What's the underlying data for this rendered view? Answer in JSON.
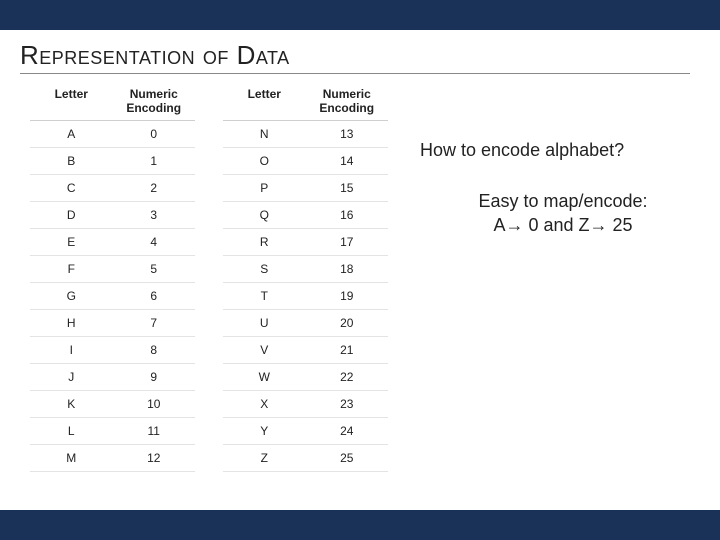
{
  "title": "Representation of Data",
  "headers": {
    "letter": "Letter",
    "encoding": "Numeric Encoding"
  },
  "chart_data": {
    "type": "table",
    "title": "Alphabet numeric encoding",
    "columns": [
      "Letter",
      "Numeric Encoding"
    ],
    "rows": [
      [
        "A",
        0
      ],
      [
        "B",
        1
      ],
      [
        "C",
        2
      ],
      [
        "D",
        3
      ],
      [
        "E",
        4
      ],
      [
        "F",
        5
      ],
      [
        "G",
        6
      ],
      [
        "H",
        7
      ],
      [
        "I",
        8
      ],
      [
        "J",
        9
      ],
      [
        "K",
        10
      ],
      [
        "L",
        11
      ],
      [
        "M",
        12
      ],
      [
        "N",
        13
      ],
      [
        "O",
        14
      ],
      [
        "P",
        15
      ],
      [
        "Q",
        16
      ],
      [
        "R",
        17
      ],
      [
        "S",
        18
      ],
      [
        "T",
        19
      ],
      [
        "U",
        20
      ],
      [
        "V",
        21
      ],
      [
        "W",
        22
      ],
      [
        "X",
        23
      ],
      [
        "Y",
        24
      ],
      [
        "Z",
        25
      ]
    ]
  },
  "table_left": [
    {
      "letter": "A",
      "enc": "0"
    },
    {
      "letter": "B",
      "enc": "1"
    },
    {
      "letter": "C",
      "enc": "2"
    },
    {
      "letter": "D",
      "enc": "3"
    },
    {
      "letter": "E",
      "enc": "4"
    },
    {
      "letter": "F",
      "enc": "5"
    },
    {
      "letter": "G",
      "enc": "6"
    },
    {
      "letter": "H",
      "enc": "7"
    },
    {
      "letter": "I",
      "enc": "8"
    },
    {
      "letter": "J",
      "enc": "9"
    },
    {
      "letter": "K",
      "enc": "10"
    },
    {
      "letter": "L",
      "enc": "11"
    },
    {
      "letter": "M",
      "enc": "12"
    }
  ],
  "table_right": [
    {
      "letter": "N",
      "enc": "13"
    },
    {
      "letter": "O",
      "enc": "14"
    },
    {
      "letter": "P",
      "enc": "15"
    },
    {
      "letter": "Q",
      "enc": "16"
    },
    {
      "letter": "R",
      "enc": "17"
    },
    {
      "letter": "S",
      "enc": "18"
    },
    {
      "letter": "T",
      "enc": "19"
    },
    {
      "letter": "U",
      "enc": "20"
    },
    {
      "letter": "V",
      "enc": "21"
    },
    {
      "letter": "W",
      "enc": "22"
    },
    {
      "letter": "X",
      "enc": "23"
    },
    {
      "letter": "Y",
      "enc": "24"
    },
    {
      "letter": "Z",
      "enc": "25"
    }
  ],
  "side": {
    "question": "How to encode alphabet?",
    "answer_l1": "Easy to map/encode:",
    "answer_l2": "A→ 0 and Z→ 25"
  }
}
